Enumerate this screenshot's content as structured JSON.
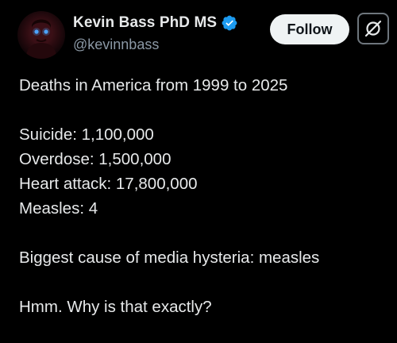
{
  "author": {
    "name": "Kevin Bass PhD MS",
    "handle": "@kevinnbass",
    "verified": true,
    "avatar_icon": "profile-photo"
  },
  "actions": {
    "follow_label": "Follow",
    "grok_icon": "grok-icon"
  },
  "post": {
    "title_line": "Deaths in America from 1999 to 2025",
    "stats": [
      "Suicide: 1,100,000",
      "Overdose: 1,500,000",
      "Heart attack: 17,800,000",
      "Measles: 4"
    ],
    "conclusion": "Biggest cause of media hysteria: measles",
    "question": "Hmm. Why is that exactly?"
  },
  "colors": {
    "background": "#000000",
    "text": "#e7e9ea",
    "secondary_text": "#8b98a5",
    "verified_badge": "#1d9bf0",
    "follow_button_bg": "#eff3f4"
  }
}
